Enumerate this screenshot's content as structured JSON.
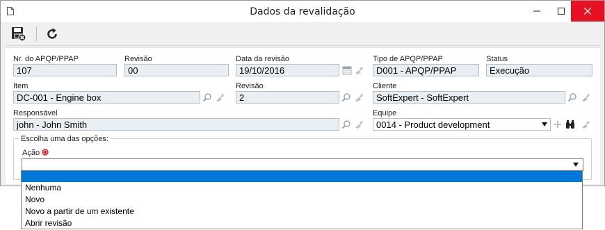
{
  "window": {
    "title": "Dados da revalidação"
  },
  "fields": {
    "nr_label": "Nr. do APQP/PPAP",
    "nr_value": "107",
    "rev_label": "Revisão",
    "rev_value": "00",
    "data_label": "Data da revisão",
    "data_value": "19/10/2016",
    "tipo_label": "Tipo de APQP/PPAP",
    "tipo_value": "D001 - APQP/PPAP",
    "status_label": "Status",
    "status_value": "Execução",
    "item_label": "Item",
    "item_value": "DC-001 - Engine box",
    "rev2_label": "Revisão",
    "rev2_value": "2",
    "cliente_label": "Cliente",
    "cliente_value": "SoftExpert - SoftExpert",
    "resp_label": "Responsável",
    "resp_value": "john - John Smith",
    "equipe_label": "Equipe",
    "equipe_value": "0014 - Product development"
  },
  "options_group": {
    "legend": "Escolha uma das opções:",
    "acao_label": "Ação",
    "acao_value": ""
  },
  "dropdown": {
    "items": [
      "",
      "Nenhuma",
      "Novo",
      "Novo a partir de um existente",
      "Abrir revisão"
    ]
  }
}
